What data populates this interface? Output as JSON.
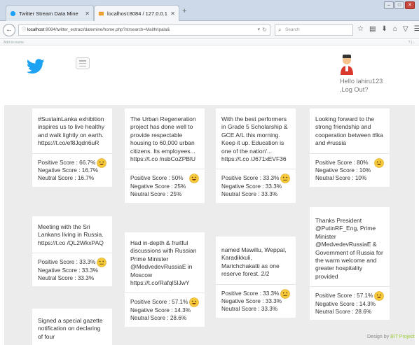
{
  "browser": {
    "tabs": [
      {
        "title": "Twitter Stream Data Mine",
        "active": false
      },
      {
        "title": "localhost:8084 / 127.0.0.1 / ...",
        "active": true
      }
    ],
    "new_tab": "+",
    "url_host": "localhost",
    "url_rest": ":8084/twitter_extract/datemine/home.php?strsearch=Maithripala&",
    "search_placeholder": "Search",
    "bookmarks_left": "Add-to-name",
    "bookmarks_right": "? | ↓"
  },
  "header": {
    "greeting": "Hello lahiru123 ,Log Out?"
  },
  "cards": [
    {
      "tweet": "#SustainLanka exhibition inspires us to live healthy and walk lightly on earth. https://t.co/ef8Jqdn6uR",
      "positive": "Positive Score : 66.7%",
      "negative": "Negative Score : 16.7%",
      "neutral": "Neutral Score : 16.7%",
      "mood": "happy"
    },
    {
      "tweet": "Meeting with the Sri Lankans living in Russia. https://t.co /QL2WkxPAQ",
      "positive": "Positive Score : 33.3%",
      "negative": "Negative Score : 33.3%",
      "neutral": "Neutral Score : 33.3%",
      "mood": "neutral"
    },
    {
      "tweet": "Signed a special gazette notification on declaring of four",
      "positive": "",
      "negative": "",
      "neutral": "",
      "mood": "none"
    },
    {
      "tweet": "The Urban Regeneration project has done well to provide respectable housing to 60,000 urban citizens. Its employees... https://t.co /nsbCoZPBlU",
      "positive": "Positive Score : 50%",
      "negative": "Negative Score : 25%",
      "neutral": "Neutral Score : 25%",
      "mood": "happy"
    },
    {
      "tweet": "Had in-depth & fruitful discussions with Russian Prime Minister @MedvedevRussiaE in Moscow https://t.co/RafqI5lJwY",
      "positive": "Positive Score : 57.1%",
      "negative": "Negative Score : 14.3%",
      "neutral": "Neutral Score : 28.6%",
      "mood": "happy"
    },
    {
      "tweet": "With the best performers in Grade 5 Scholarship & GCE A/L this morning. Keep it up. Education is one of the nation'... https://t.co /J671xEVF36",
      "positive": "Positive Score : 33.3%",
      "negative": "Negative Score : 33.3%",
      "neutral": "Neutral Score : 33.3%",
      "mood": "neutral"
    },
    {
      "tweet": "named Mawillu, Weppal, Karadikkuli, Marichchakatti as one reserve forest. 2/2",
      "positive": "Positive Score : 33.3%",
      "negative": "Negative Score : 33.3%",
      "neutral": "Neutral Score : 33.3%",
      "mood": "neutral"
    },
    {
      "tweet": "Looking forward to the strong friendship and cooperation between #lka and #russia",
      "positive": "Positive Score : 80%",
      "negative": "Negative Score : 10%",
      "neutral": "Neutral Score : 10%",
      "mood": "happy"
    },
    {
      "tweet": "Thanks President @PutinRF_Eng, Prime Minister @MedvedevRussiaE & Government of Russia for the warm welcome and greater hospitality provided",
      "positive": "Positive Score : 57.1%",
      "negative": "Negative Score : 14.3%",
      "neutral": "Neutral Score : 28.6%",
      "mood": "happy"
    }
  ],
  "footer": {
    "prefix": "Design by ",
    "brand": "BIT Project"
  },
  "colors": {
    "twitter_blue": "#1da1f2",
    "board_bg": "#ececec",
    "emoji_yellow": "#f5c93a",
    "footer_brand": "#9acd32"
  }
}
